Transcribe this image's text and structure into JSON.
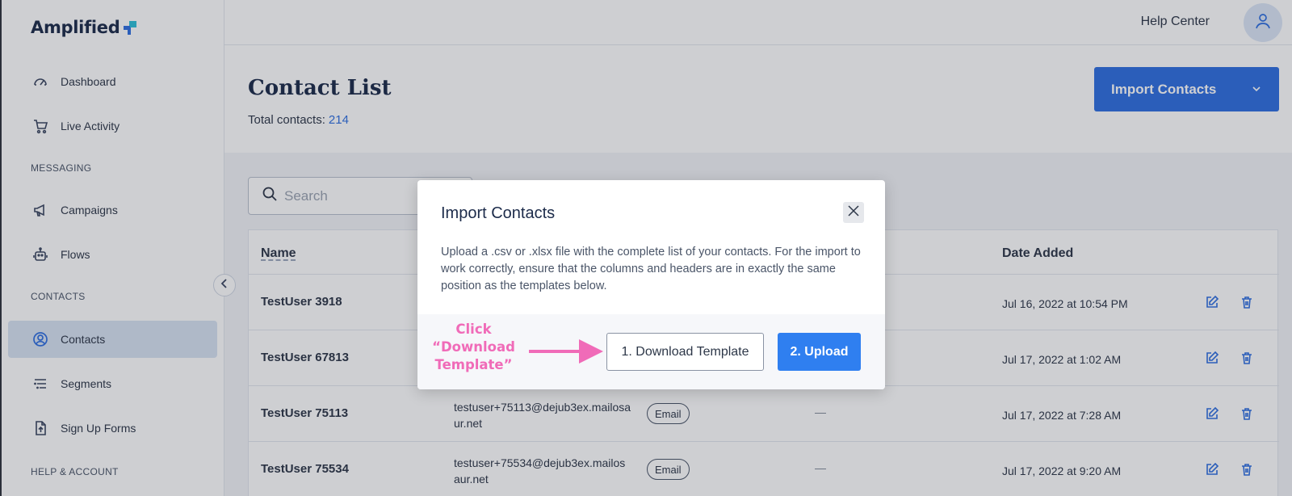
{
  "app": {
    "logo_text": "Amplified"
  },
  "sidebar": {
    "items": [
      {
        "label": "Dashboard",
        "icon": "speedometer-icon"
      },
      {
        "label": "Live Activity",
        "icon": "cart-icon"
      },
      {
        "label": "Campaigns",
        "icon": "megaphone-icon"
      },
      {
        "label": "Flows",
        "icon": "robot-icon"
      },
      {
        "label": "Contacts",
        "icon": "user-circle-icon",
        "active": true
      },
      {
        "label": "Segments",
        "icon": "list-filter-icon"
      },
      {
        "label": "Sign Up Forms",
        "icon": "form-upload-icon"
      }
    ],
    "sections": {
      "messaging": "MESSAGING",
      "contacts": "CONTACTS",
      "help_account": "HELP & ACCOUNT"
    }
  },
  "topbar": {
    "help_label": "Help Center"
  },
  "header": {
    "title": "Contact List",
    "total_label": "Total contacts:",
    "total_value": "214",
    "import_button": "Import Contacts"
  },
  "search": {
    "placeholder": "Search"
  },
  "table": {
    "columns": {
      "name": "Name",
      "date_added": "Date Added"
    },
    "rows": [
      {
        "name": "TestUser 3918",
        "email": "",
        "channel": "",
        "extra": "",
        "date": "Jul 16, 2022 at 10:54 PM"
      },
      {
        "name": "TestUser 67813",
        "email": "",
        "channel": "",
        "extra": "",
        "date": "Jul 17, 2022 at 1:02 AM"
      },
      {
        "name": "TestUser 75113",
        "email": "testuser+75113@dejub3ex.mailosaur.net",
        "channel": "Email",
        "extra": "—",
        "date": "Jul 17, 2022 at 7:28 AM"
      },
      {
        "name": "TestUser 75534",
        "email": "testuser+75534@dejub3ex.mailosaur.net",
        "channel": "Email",
        "extra": "—",
        "date": "Jul 17, 2022 at 9:20 AM"
      }
    ]
  },
  "modal": {
    "title": "Import Contacts",
    "description": "Upload a .csv or .xlsx file with the complete list of your contacts. For the import to work correctly, ensure that the columns and headers are in exactly the same position as the templates below.",
    "tip": "Click “Download Template”",
    "download_button": "1. Download Template",
    "upload_button": "2. Upload"
  },
  "colors": {
    "primary": "#2f6fe0",
    "upload": "#2f7ff0",
    "tip": "#f06bb8",
    "logo_accent": "#2dbfd9"
  }
}
